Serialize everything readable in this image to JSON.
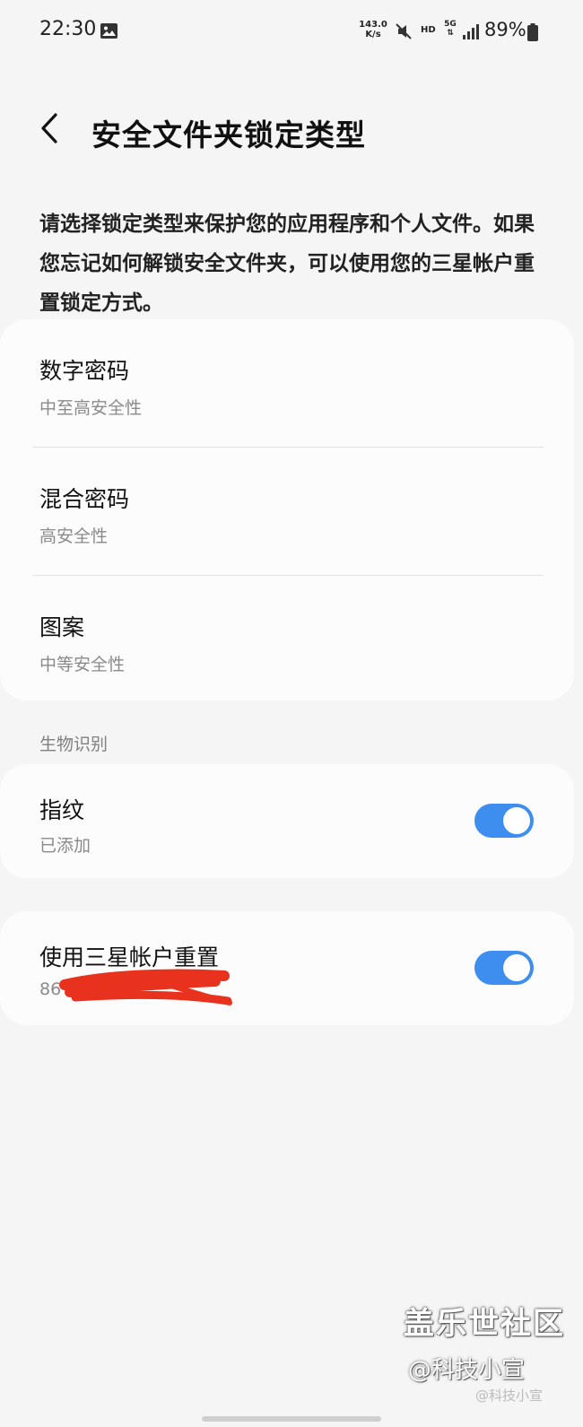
{
  "status_bar": {
    "time": "22:30",
    "speed_value": "143.0",
    "speed_unit": "K/s",
    "hd": "HD",
    "network": "5G",
    "battery": "89%"
  },
  "header": {
    "back_icon": "chevron-left-icon",
    "title": "安全文件夹锁定类型"
  },
  "description": "请选择锁定类型来保护您的应用程序和个人文件。如果您忘记如何解锁安全文件夹，可以使用您的三星帐户重置锁定方式。",
  "lock_types": [
    {
      "title": "数字密码",
      "subtitle": "中至高安全性"
    },
    {
      "title": "混合密码",
      "subtitle": "高安全性"
    },
    {
      "title": "图案",
      "subtitle": "中等安全性"
    }
  ],
  "biometrics": {
    "section_title": "生物识别",
    "fingerprint": {
      "title": "指纹",
      "subtitle": "已添加",
      "enabled": true
    }
  },
  "account_reset": {
    "title": "使用三星帐户重置",
    "enabled": true,
    "subtitle_partial": "86"
  },
  "colors": {
    "accent": "#3e8ef0",
    "redaction": "#e8321e",
    "background": "#f5f5f5",
    "card": "#fcfcfc"
  },
  "watermark": {
    "site": "盖乐世社区",
    "handle": "@科技小宣",
    "weibo": "@科技小宣"
  }
}
